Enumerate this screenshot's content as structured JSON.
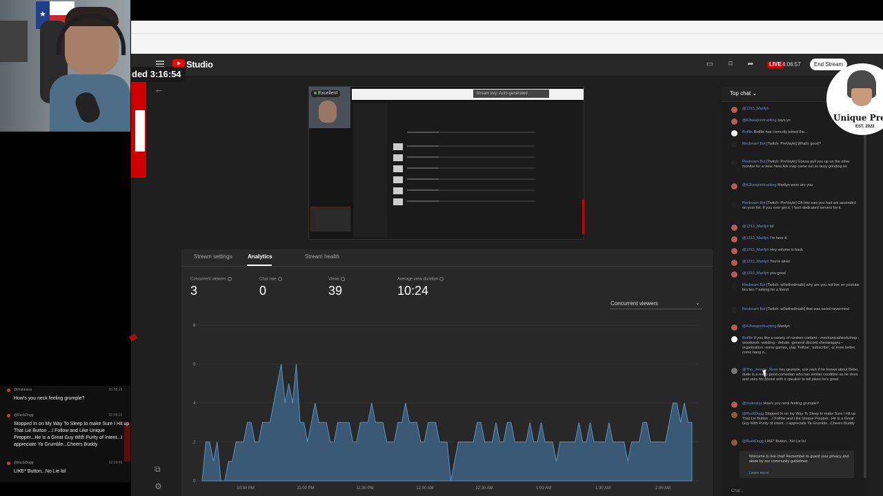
{
  "webcam": {
    "ended_badge": "ded 3:16:54"
  },
  "studio": {
    "logo_word": "Studio",
    "live_label": "LIVE",
    "live_time": "4:06:57",
    "end_stream_label": "End Stream"
  },
  "preview": {
    "quality_label": "Excellent",
    "stream_key_label": "Stream key: Auto-generated"
  },
  "tabs": [
    "Stream settings",
    "Analytics",
    "Stream health"
  ],
  "metrics": [
    {
      "label": "Concurrent viewers",
      "value": "3"
    },
    {
      "label": "Chat rate",
      "value": "0"
    },
    {
      "label": "Views",
      "value": "39"
    },
    {
      "label": "Average view duration",
      "value": "10:24"
    }
  ],
  "dropdown": {
    "selected": "Concurrent viewers"
  },
  "chart_data": {
    "type": "area",
    "ylim": [
      0,
      8
    ],
    "y_ticks": [
      "8",
      "6",
      "4",
      "2",
      "0"
    ],
    "x_ticks": [
      "10:30 PM",
      "11:00 PM",
      "11:30 PM",
      "12:00 AM",
      "12:30 AM",
      "1:00 AM",
      "1:30 AM",
      "2:00 AM"
    ],
    "color": "#3f6a8f",
    "values": [
      0,
      2,
      2,
      1,
      2,
      0,
      0,
      1,
      1,
      2,
      2,
      2,
      3,
      3,
      2,
      2,
      3,
      3,
      3,
      4,
      5,
      6,
      4,
      5,
      4,
      6,
      3,
      3,
      2,
      3,
      4,
      3,
      3,
      3,
      2,
      2,
      3,
      3,
      3,
      3,
      2,
      2,
      3,
      3,
      3,
      4,
      3,
      3,
      3,
      2,
      2,
      2,
      3,
      3,
      4,
      3,
      3,
      3,
      2,
      2,
      3,
      3,
      3,
      2,
      2,
      2,
      0,
      1,
      2,
      2,
      2,
      2,
      2,
      3,
      3,
      2,
      2,
      2,
      3,
      2,
      2,
      3,
      3,
      2,
      2,
      2,
      2,
      3,
      2,
      2,
      3,
      2,
      2,
      2,
      1,
      2,
      2,
      2,
      2,
      2,
      3,
      2,
      2,
      3,
      2,
      2,
      2,
      2,
      3,
      2,
      2,
      2,
      2,
      1,
      2,
      2,
      2,
      3,
      3,
      2,
      2,
      2,
      2,
      2,
      3,
      4,
      4,
      3,
      4,
      3,
      3
    ]
  },
  "chat": {
    "header": "Top chat",
    "messages": [
      {
        "author": "@1313_Marilyn",
        "text": ""
      },
      {
        "author": "@K2keepontrucking",
        "text": "says yo"
      },
      {
        "author": "Botfile",
        "text": "Botfile has correctly joined the..."
      },
      {
        "author": "Restream Bot",
        "text": "[Twitch: PreVayle] What's good?"
      },
      {
        "author": "Restream Bot",
        "text": "[Twitch: PreVayle] Gonna pull you up on the other monitor for a view. New Ark map came out so busy grinding lol"
      },
      {
        "author": "@K2keepontrucking",
        "text": "Marilyn were are you"
      },
      {
        "author": "Restream Bot",
        "text": "[Twitch: PreVayle] Oh btw saw you had ark ascended on your list. If you ever get it, I host dedicated servers for it"
      },
      {
        "author": "@1313_Marilyn",
        "text": "lol"
      },
      {
        "author": "@1313_Marilyn",
        "text": "I'm here K"
      },
      {
        "author": "@1313_Marilyn",
        "text": "Hey volume is back"
      },
      {
        "author": "@1313_Marilyn",
        "text": "You're alive!"
      },
      {
        "author": "@1313_Marilyn",
        "text": "you good"
      },
      {
        "author": "Restream Bot",
        "text": "[Twitch: w0tsthedmath] why are you not live on youtube bro bro ? asking for a friend"
      },
      {
        "author": "Restream Bot",
        "text": "[Twitch: w0tsthedmath] that was weird nevermind"
      },
      {
        "author": "@K2keepontrucking",
        "text": "Marilyn"
      },
      {
        "author": "Botfile",
        "text": "If you like a variety of random content - mechanical/workshop -woodwork -welding - debate -general discord shenanigans - organization -some games, slap 'Follow', 'subscribe', or even better, come hang o..."
      },
      {
        "author": "@The_Jeremy_Ryan",
        "text": "hey grumple, ask zack if he knows about Bebe, dude is a really good comedian who has similar condition as he does and uses his phone with a speaker to tell jokes he's great"
      },
      {
        "author": "@rnukesiss",
        "text": "How's you neck feeling grumple?"
      },
      {
        "author": "@RuckDogg",
        "text": "Stopped In on my Way To Sleep to make Sure I Hit up That Lie Button ...I Follow and Like Unique Prepper...He is a Great Guy With Purity of Intent...I appreciate Ya Grumble...Cheers Buddy"
      },
      {
        "author": "@RuckDogg",
        "text": "LIKE* Button...No Lie lol"
      }
    ],
    "welcome": "Welcome to live chat! Remember to guard your privacy and abide by our community guidelines.",
    "learn_more": "Learn more",
    "input_placeholder": "Chat..."
  },
  "logo": {
    "name": "Unique Prep",
    "est": "EST. 2022"
  },
  "overlay_chat": [
    {
      "user": "@rnukesiss",
      "time": "01:58:25",
      "text": "How's you neck feeling grumple?"
    },
    {
      "user": "@RuckDogg",
      "time": "02:08:22",
      "text": "Stopped In on My Way To Sleep to make Sure I Hit up That Lie Button ...I Follow and Like Unique Prepper...He is a Great Guy With Purity of Intent...I appreciate Ya Grumble...Cheers Buddy"
    },
    {
      "user": "@RuckDogg",
      "time": "02:08:45",
      "text": "LIKE* Button...No Lie lol"
    }
  ]
}
